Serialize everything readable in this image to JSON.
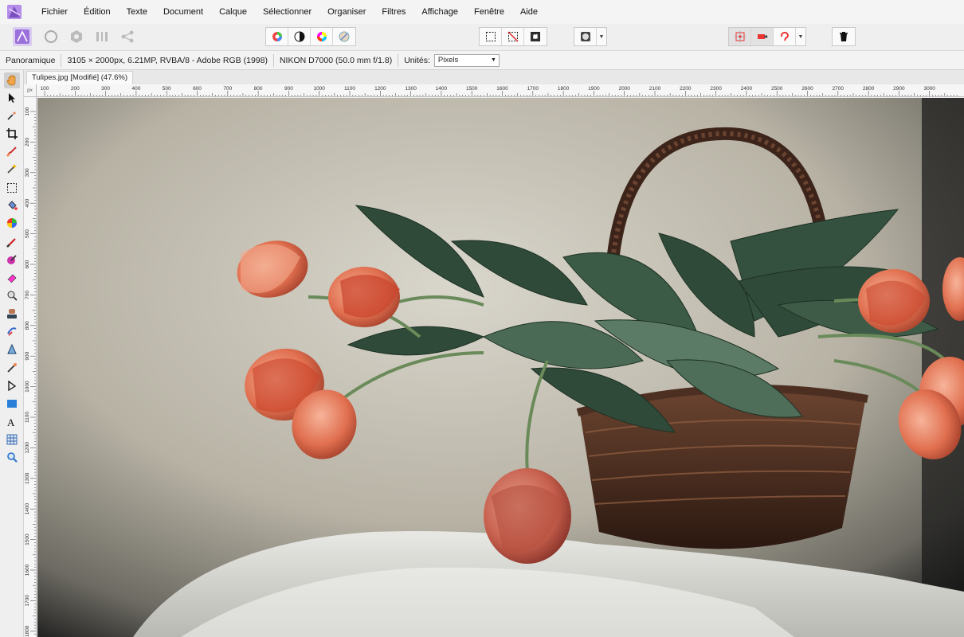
{
  "menu": [
    "Fichier",
    "Édition",
    "Texte",
    "Document",
    "Calque",
    "Sélectionner",
    "Organiser",
    "Filtres",
    "Affichage",
    "Fenêtre",
    "Aide"
  ],
  "context": {
    "persona": "Panoramique",
    "dimensions": "3105 × 2000px, 6.21MP, RVBA/8 - Adobe RGB (1998)",
    "camera": "NIKON D7000 (50.0 mm f/1.8)",
    "units_label": "Unités:",
    "units_value": "Pixels"
  },
  "document": {
    "tab_title": "Tulipes.jpg [Modifié] (47.6%)"
  },
  "ruler": {
    "unit": "px",
    "top_ticks": [
      "100",
      "200",
      "300",
      "400",
      "500",
      "600",
      "700",
      "800",
      "900",
      "1000",
      "1100",
      "1200",
      "1300",
      "1400",
      "1500",
      "1600",
      "1700",
      "1800",
      "1900",
      "2000",
      "2100",
      "2200",
      "2300",
      "2400",
      "2500",
      "2600",
      "2700",
      "2800",
      "2900",
      "3000"
    ],
    "left_ticks": [
      "100",
      "200",
      "300",
      "400",
      "500",
      "600",
      "700",
      "800",
      "900",
      "1000",
      "1100",
      "1200",
      "1300",
      "1400",
      "1500",
      "1600",
      "1700",
      "1800"
    ]
  },
  "tools": [
    "hand-icon",
    "move-icon",
    "color-picker-icon",
    "crop-icon",
    "paint-brush-icon",
    "selection-brush-icon",
    "rect-marquee-icon",
    "flood-fill-icon",
    "gradient-icon",
    "brush-icon",
    "color-replace-icon",
    "eraser-icon",
    "dodge-icon",
    "burn-icon",
    "clone-icon",
    "blemish-icon",
    "smudge-icon",
    "pen-icon",
    "rectangle-icon",
    "text-icon",
    "mesh-icon",
    "zoom-icon"
  ],
  "colors": {
    "accent": "#7a4fc0",
    "active_tool_bg": "#cfcfcf"
  }
}
